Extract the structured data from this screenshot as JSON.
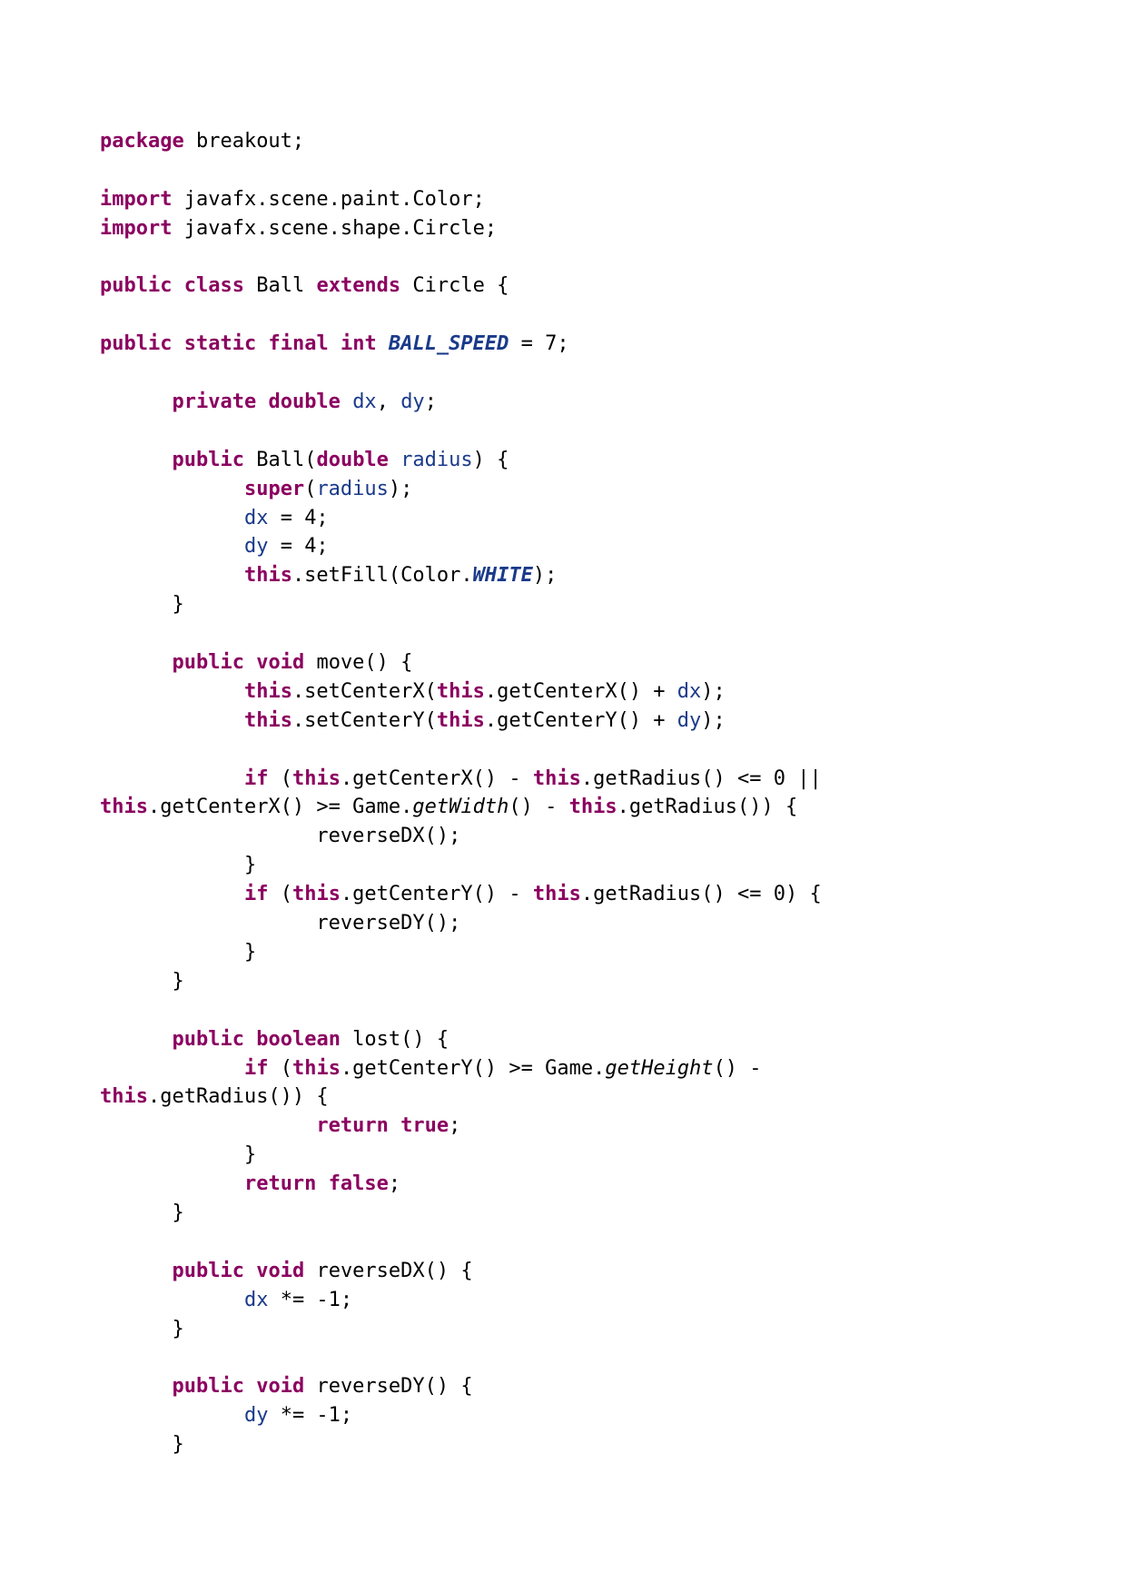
{
  "code": {
    "l1_kw1": "package",
    "l1_txt1": " breakout;",
    "l3_kw1": "import",
    "l3_txt1": " javafx.scene.paint.Color;",
    "l4_kw1": "import",
    "l4_txt1": " javafx.scene.shape.Circle;",
    "l6_kw1": "public",
    "l6_kw2": "class",
    "l6_txt1": " Ball ",
    "l6_kw3": "extends",
    "l6_txt2": " Circle {",
    "l8_kw1": "public",
    "l8_kw2": "static",
    "l8_kw3": "final",
    "l8_kw4": "int",
    "l8_const": "BALL_SPEED",
    "l8_txt1": " = 7;",
    "l10_kw1": "private",
    "l10_kw2": "double",
    "l10_f1": "dx",
    "l10_txt1": ", ",
    "l10_f2": "dy",
    "l10_txt2": ";",
    "l12_kw1": "public",
    "l12_txt1": " Ball(",
    "l12_kw2": "double",
    "l12_f1": "radius",
    "l12_txt2": ") {",
    "l13_kw1": "super",
    "l13_txt1": "(",
    "l13_f1": "radius",
    "l13_txt2": ");",
    "l14_f1": "dx",
    "l14_txt1": " = 4;",
    "l15_f1": "dy",
    "l15_txt1": " = 4;",
    "l16_kw1": "this",
    "l16_txt1": ".setFill(Color.",
    "l16_const": "WHITE",
    "l16_txt2": ");",
    "l17_txt1": "}",
    "l19_kw1": "public",
    "l19_kw2": "void",
    "l19_txt1": " move() {",
    "l20_kw1": "this",
    "l20_txt1": ".setCenterX(",
    "l20_kw2": "this",
    "l20_txt2": ".getCenterX() + ",
    "l20_f1": "dx",
    "l20_txt3": ");",
    "l21_kw1": "this",
    "l21_txt1": ".setCenterY(",
    "l21_kw2": "this",
    "l21_txt2": ".getCenterY() + ",
    "l21_f1": "dy",
    "l21_txt3": ");",
    "l23_kw1": "if",
    "l23_txt1": " (",
    "l23_kw2": "this",
    "l23_txt2": ".getCenterX() - ",
    "l23_kw3": "this",
    "l23_txt3": ".getRadius() <= 0 ||",
    "l24_kw1": "this",
    "l24_txt1": ".getCenterX() >= Game.",
    "l24_ital": "getWidth",
    "l24_txt2": "() - ",
    "l24_kw2": "this",
    "l24_txt3": ".getRadius()) {",
    "l25_txt1": "reverseDX();",
    "l26_txt1": "}",
    "l27_kw1": "if",
    "l27_txt1": " (",
    "l27_kw2": "this",
    "l27_txt2": ".getCenterY() - ",
    "l27_kw3": "this",
    "l27_txt3": ".getRadius() <= 0) {",
    "l28_txt1": "reverseDY();",
    "l29_txt1": "}",
    "l30_txt1": "}",
    "l32_kw1": "public",
    "l32_kw2": "boolean",
    "l32_txt1": " lost() {",
    "l33_kw1": "if",
    "l33_txt1": " (",
    "l33_kw2": "this",
    "l33_txt2": ".getCenterY() >= Game.",
    "l33_ital": "getHeight",
    "l33_txt3": "() -",
    "l34_kw1": "this",
    "l34_txt1": ".getRadius()) {",
    "l35_kw1": "return",
    "l35_kw2": "true",
    "l35_txt1": ";",
    "l36_txt1": "}",
    "l37_kw1": "return",
    "l37_kw2": "false",
    "l37_txt1": ";",
    "l38_txt1": "}",
    "l40_kw1": "public",
    "l40_kw2": "void",
    "l40_txt1": " reverseDX() {",
    "l41_f1": "dx",
    "l41_txt1": " *= -1;",
    "l42_txt1": "}",
    "l44_kw1": "public",
    "l44_kw2": "void",
    "l44_txt1": " reverseDY() {",
    "l45_f1": "dy",
    "l45_txt1": " *= -1;",
    "l46_txt1": "}"
  }
}
